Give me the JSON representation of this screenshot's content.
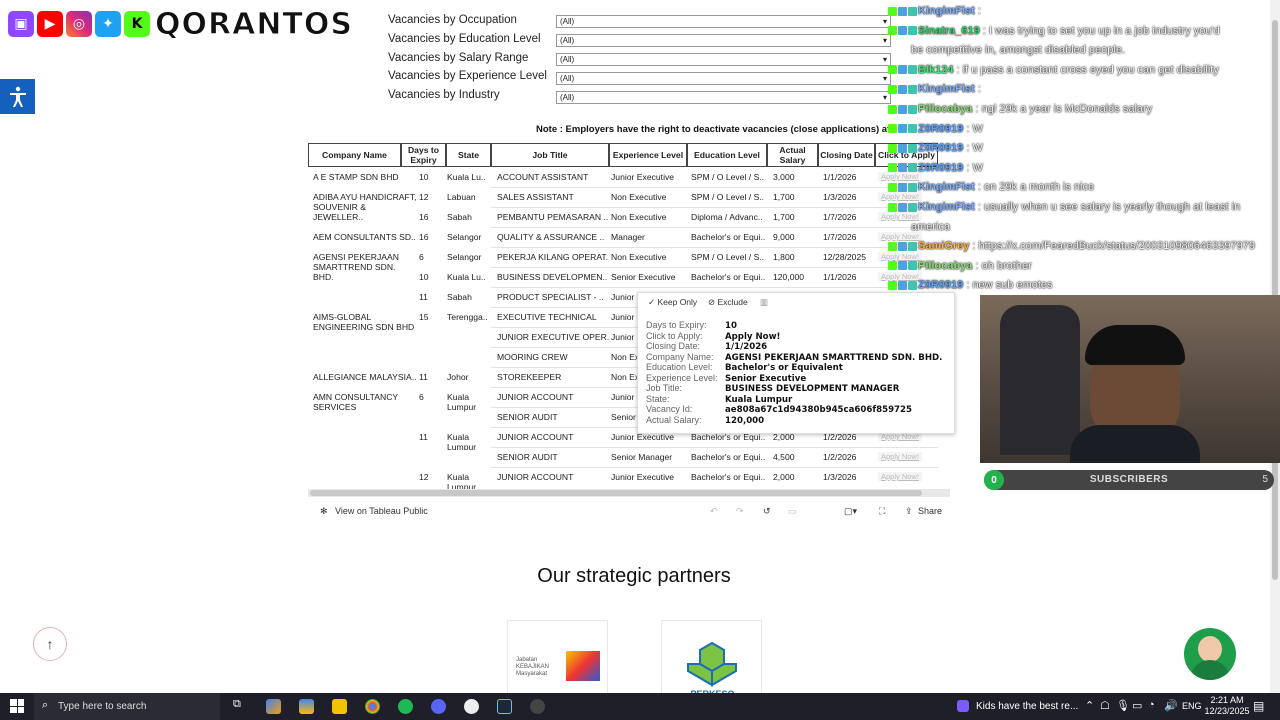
{
  "overlay": {
    "channel_name": "QORANTOS",
    "icons": [
      "twitch-icon",
      "youtube-icon",
      "instagram-icon",
      "twitter-icon",
      "kick-icon"
    ]
  },
  "filters": [
    {
      "label": "Vacancies by Occupation",
      "value": "(All)"
    },
    {
      "label": "Vacancies by Education Level",
      "value": "(All)"
    },
    {
      "label": "Vacancies by Salary Range",
      "value": "(All)"
    },
    {
      "label": "Vacancies by Experience Level",
      "value": "(All)"
    },
    {
      "label": "Vacancies by Industry",
      "value": "(All)"
    }
  ],
  "note": "Note : Employers have the right to deactivate vacancies (close applications) at",
  "table": {
    "headers": [
      "Company Name",
      "Days to Expiry",
      "State",
      "Job Title",
      "Experience Level",
      "Education Level",
      "Actual Salary",
      "Closing Date",
      "Click to Apply"
    ],
    "apply_label": "Apply Now!",
    "rows": [
      {
        "company": "A E STAMP SDN BHD",
        "days": "10",
        "state": "Kuala Lu..",
        "job": "ACCOUNT ASSISTANT",
        "exp": "Junior Executive",
        "edu": "SPM / O Level / S..",
        "salary": "3,000",
        "closing": "1/1/2026"
      },
      {
        "company": "ADIBA AYU HANDICRAFT, SOUVENIR & JEWELLER..",
        "days": "12",
        "state": "Labuan",
        "job": "SALES ASSISTANT",
        "exp": "Non Executive",
        "edu": "SPM / O Level / S..",
        "salary": "1,700",
        "closing": "1/3/2026"
      },
      {
        "company": "",
        "days": "16",
        "state": "Sabah",
        "job": "PEMBANTU PEMASARAN ..",
        "exp": "Non Executive",
        "edu": "Diploma / Advanc..",
        "salary": "1,700",
        "closing": "1/7/2026"
      },
      {
        "company": "AEM CONSULTANTS SD..",
        "days": "16",
        "state": "Selangor",
        "job": "QUALITY & ASSURANCE ..",
        "exp": "Manager",
        "edu": "Bachelor's or Equi..",
        "salary": "9,000",
        "closing": "1/7/2026"
      },
      {
        "company": "AGENSI PEKERJAAN SMARTTREND SDN. BHD.",
        "days": "6",
        "state": "Selangor",
        "job": "PEKERJA KILANG OPERAT..",
        "exp": "Non Executive",
        "edu": "SPM / O Level / S..",
        "salary": "1,800",
        "closing": "12/28/2025"
      },
      {
        "company": "",
        "days": "10",
        "state": "Kuala Lu..",
        "job": "BUSINESS DEVELOPMEN..",
        "exp": "Senior Executive",
        "edu": "Bachelor's or Equi..",
        "salary": "120,000",
        "closing": "1/1/2026"
      },
      {
        "company": "",
        "days": "11",
        "state": "Sabah",
        "job": "PRODUCT SPECIALIST - ..",
        "exp": "Junior",
        "edu": "",
        "salary": "",
        "closing": ""
      },
      {
        "company": "AIMS-GLOBAL ENGINEERING SDN BHD",
        "days": "15",
        "state": "Terengga..",
        "job": "EXECUTIVE TECHNICAL",
        "exp": "Junior",
        "edu": "",
        "salary": "",
        "closing": ""
      },
      {
        "company": "",
        "days": "",
        "state": "",
        "job": "JUNIOR EXECUTIVE OPER..",
        "exp": "Junior",
        "edu": "",
        "salary": "",
        "closing": ""
      },
      {
        "company": "",
        "days": "",
        "state": "",
        "job": "MOORING CREW",
        "exp": "Non Ex",
        "edu": "",
        "salary": "",
        "closing": ""
      },
      {
        "company": "ALLEGIANCE MALAYSIA..",
        "days": "11",
        "state": "Johor",
        "job": "STOREKEEPER",
        "exp": "Non Ex",
        "edu": "",
        "salary": "",
        "closing": ""
      },
      {
        "company": "AMN CONSULTANCY SERVICES",
        "days": "6",
        "state": "Kuala Lumpur",
        "job": "JUNIOR ACCOUNT",
        "exp": "Junior",
        "edu": "",
        "salary": "",
        "closing": ""
      },
      {
        "company": "",
        "days": "",
        "state": "",
        "job": "SENIOR AUDIT",
        "exp": "Senior",
        "edu": "",
        "salary": "",
        "closing": ""
      },
      {
        "company": "",
        "days": "11",
        "state": "Kuala Lumpur",
        "job": "JUNIOR ACCOUNT",
        "exp": "Junior Executive",
        "edu": "Bachelor's or Equi..",
        "salary": "2,000",
        "closing": "1/2/2026"
      },
      {
        "company": "",
        "days": "",
        "state": "",
        "job": "SENIOR AUDIT",
        "exp": "Senior Manager",
        "edu": "Bachelor's or Equi..",
        "salary": "4,500",
        "closing": "1/2/2026"
      },
      {
        "company": "",
        "days": "12",
        "state": "Kuala Lumpur",
        "job": "JUNIOR ACCOUNT",
        "exp": "Junior Executive",
        "edu": "Bachelor's or Equi..",
        "salary": "2,000",
        "closing": "1/3/2026"
      }
    ]
  },
  "tooltip": {
    "keep_only": "Keep Only",
    "exclude": "Exclude",
    "fields": [
      {
        "k": "Days to Expiry:",
        "v": "10"
      },
      {
        "k": "Click to Apply:",
        "v": "Apply Now!"
      },
      {
        "k": "Closing Date:",
        "v": "1/1/2026"
      },
      {
        "k": "Company Name:",
        "v": "AGENSI PEKERJAAN SMARTTREND SDN. BHD."
      },
      {
        "k": "Education Level:",
        "v": "Bachelor's or Equivalent"
      },
      {
        "k": "Experience Level:",
        "v": "Senior Executive"
      },
      {
        "k": "Job Title:",
        "v": "BUSINESS DEVELOPMENT MANAGER"
      },
      {
        "k": "State:",
        "v": "Kuala Lumpur"
      },
      {
        "k": "Vacancy Id:",
        "v": "ae808a67c1d94380b945ca606f859725"
      },
      {
        "k": "Actual Salary:",
        "v": "120,000"
      }
    ]
  },
  "tableau": {
    "view_label": "View on Tableau Public",
    "share_label": "Share"
  },
  "partners": {
    "title": "Our strategic partners",
    "logo1_text": "Jabatan KEBAJIKAN Masyarakat",
    "logo2_text": "PERKESO"
  },
  "chat": [
    {
      "user": "KingimFist",
      "color": "#7ab0ff",
      "msg": ""
    },
    {
      "user": "Sinatra_619",
      "color": "#2fd36d",
      "msg": "I was trying to set you up in a job industry       you'd"
    },
    {
      "user": "",
      "color": "#fff",
      "msg": "be competitive in, amongst disabled people."
    },
    {
      "user": "Blk124",
      "color": "#3ee67a",
      "msg": "if u pass a constant cross eyed you can get disability"
    },
    {
      "user": "KingimFist",
      "color": "#7ab0ff",
      "msg": ""
    },
    {
      "user": "Pillocabya",
      "color": "#8ee07a",
      "msg": "ngl 29k a year is McDonalds salary"
    },
    {
      "user": "Z0R0919",
      "color": "#5aa3ff",
      "msg": "W"
    },
    {
      "user": "Z0R0919",
      "color": "#5aa3ff",
      "msg": "W"
    },
    {
      "user": "Z0R0919",
      "color": "#5aa3ff",
      "msg": "W"
    },
    {
      "user": "KingimFist",
      "color": "#7ab0ff",
      "msg": "on 29k a month is nice"
    },
    {
      "user": "KingimFist",
      "color": "#7ab0ff",
      "msg": "usually when u see salary is yearly though at least in"
    },
    {
      "user": "",
      "color": "#fff",
      "msg": "america"
    },
    {
      "user": "SamiGrey",
      "color": "#ffb347",
      "msg": "https://x.com/FearedBuck/status/2003109806463397979"
    },
    {
      "user": "Pillocabya",
      "color": "#8ee07a",
      "msg": "oh brother"
    },
    {
      "user": "Z0R0919",
      "color": "#5aa3ff",
      "msg": "new sub emotes"
    }
  ],
  "subscribers": {
    "label": "SUBSCRIBERS",
    "current": "0",
    "goal": "5"
  },
  "taskbar": {
    "search_placeholder": "Type here to search",
    "media_text": "Kids have the best re...",
    "lang": "ENG",
    "time": "2:21 AM",
    "date": "12/23/2025"
  }
}
